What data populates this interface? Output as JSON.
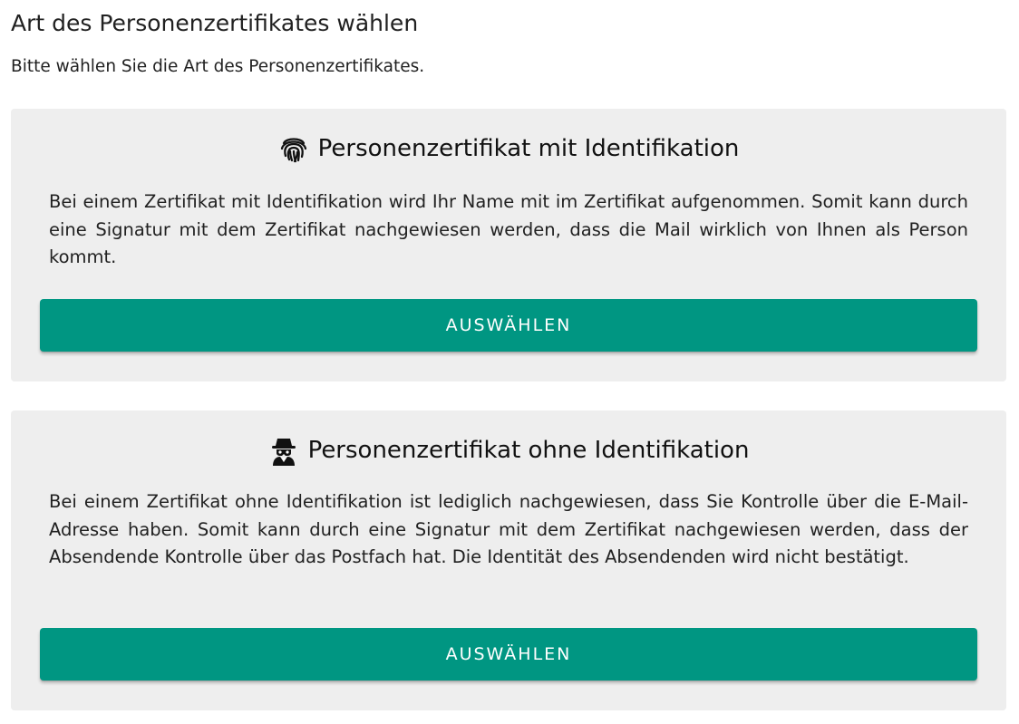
{
  "page": {
    "title": "Art des Personenzertifikates wählen",
    "subtitle": "Bitte wählen Sie die Art des Personenzertifikates."
  },
  "options": [
    {
      "icon": "fingerprint-icon",
      "title": "Personenzertifikat mit Identifikation",
      "description": "Bei einem Zertifikat mit Identifikation wird Ihr Name mit im Zertifikat aufgenommen. Somit kann durch eine Signatur mit dem Zertifikat nachgewiesen werden, dass die Mail wirklich von Ihnen als Person kommt.",
      "button_label": "AUSWÄHLEN"
    },
    {
      "icon": "incognito-spy-icon",
      "title": "Personenzertifikat ohne Identifikation",
      "description": "Bei einem Zertifikat ohne Identifikation ist lediglich nachgewiesen, dass Sie Kontrolle über die E-Mail-Adresse haben. Somit kann durch eine Signatur mit dem Zertifikat nachgewiesen werden, dass der Absendende Kontrolle über das Postfach hat. Die Identität des Absendenden wird nicht bestätigt.",
      "button_label": "AUSWÄHLEN"
    }
  ],
  "colors": {
    "button_background": "#009682",
    "card_background": "#eeeeee",
    "text": "#212121"
  }
}
